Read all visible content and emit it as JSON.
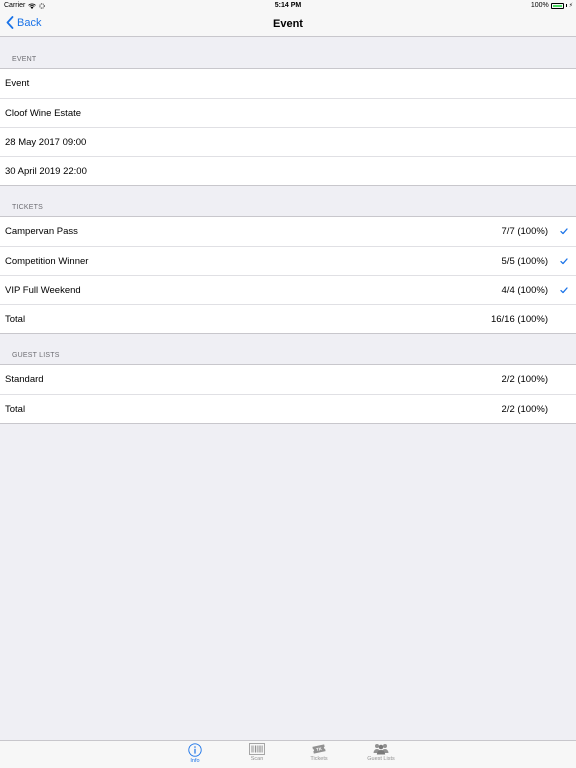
{
  "status_bar": {
    "carrier": "Carrier",
    "time": "5:14 PM",
    "battery": "100%"
  },
  "nav": {
    "back_label": "Back",
    "title": "Event"
  },
  "sections": {
    "event": {
      "header": "EVENT",
      "rows": [
        "Event",
        "Cloof Wine Estate",
        "28 May 2017 09:00",
        "30 April 2019 22:00"
      ]
    },
    "tickets": {
      "header": "TICKETS",
      "rows": [
        {
          "label": "Campervan Pass",
          "value": "7/7 (100%)"
        },
        {
          "label": "Competition Winner",
          "value": "5/5 (100%)"
        },
        {
          "label": "VIP Full Weekend",
          "value": "4/4 (100%)"
        },
        {
          "label": "Total",
          "value": "16/16 (100%)"
        }
      ]
    },
    "guest_lists": {
      "header": "GUEST LISTS",
      "rows": [
        {
          "label": "Standard",
          "value": "2/2 (100%)"
        },
        {
          "label": "Total",
          "value": "2/2 (100%)"
        }
      ]
    }
  },
  "tab_bar": {
    "tabs": [
      {
        "label": "Info",
        "icon": "info-icon",
        "active": true
      },
      {
        "label": "Scan",
        "icon": "barcode-icon",
        "active": false
      },
      {
        "label": "Tickets",
        "icon": "ticket-icon",
        "active": false
      },
      {
        "label": "Guest Lists",
        "icon": "people-icon",
        "active": false
      }
    ]
  },
  "colors": {
    "accent": "#1a73e8",
    "battery": "#4cd964",
    "background": "#efeff4"
  }
}
